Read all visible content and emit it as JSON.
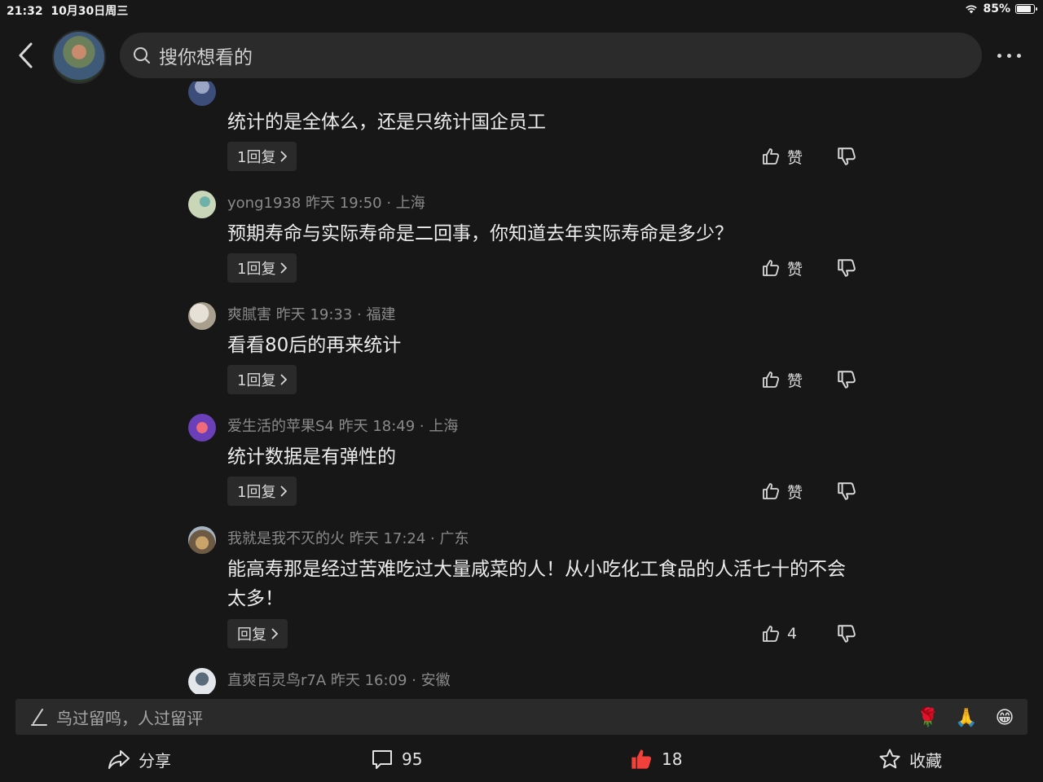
{
  "status_bar": {
    "time": "21:32",
    "date": "10月30日周三",
    "battery": "85%"
  },
  "header": {
    "search_placeholder": "搜你想看的"
  },
  "comments": [
    {
      "meta": "",
      "text": "统计的是全体么，还是只统计国企员工",
      "reply": "1回复",
      "like": "赞"
    },
    {
      "meta": "yong1938  昨天 19:50 · 上海",
      "text": "预期寿命与实际寿命是二回事，你知道去年实际寿命是多少？",
      "reply": "1回复",
      "like": "赞"
    },
    {
      "meta": "爽腻害  昨天 19:33 · 福建",
      "text": "看看80后的再来统计",
      "reply": "1回复",
      "like": "赞"
    },
    {
      "meta": "爱生活的苹果S4  昨天 18:49 · 上海",
      "text": "统计数据是有弹性的",
      "reply": "1回复",
      "like": "赞"
    },
    {
      "meta": "我就是我不灭的火  昨天 17:24 · 广东",
      "text": "能高寿那是经过苦难吃过大量咸菜的人！从小吃化工食品的人活七十的不会太多！",
      "reply": "回复",
      "like": "4"
    },
    {
      "meta": "直爽百灵鸟r7A  昨天 16:09 · 安徽",
      "text": "",
      "reply": "",
      "like": ""
    }
  ],
  "comment_input": {
    "placeholder": "鸟过留鸣，人过留评"
  },
  "emojis": [
    "🌹",
    "🙏",
    "😁"
  ],
  "toolbar": {
    "share": "分享",
    "comments": "95",
    "likes": "18",
    "favorite": "收藏"
  },
  "colors": {
    "background": "#171717",
    "like_active": "#f2413a"
  }
}
